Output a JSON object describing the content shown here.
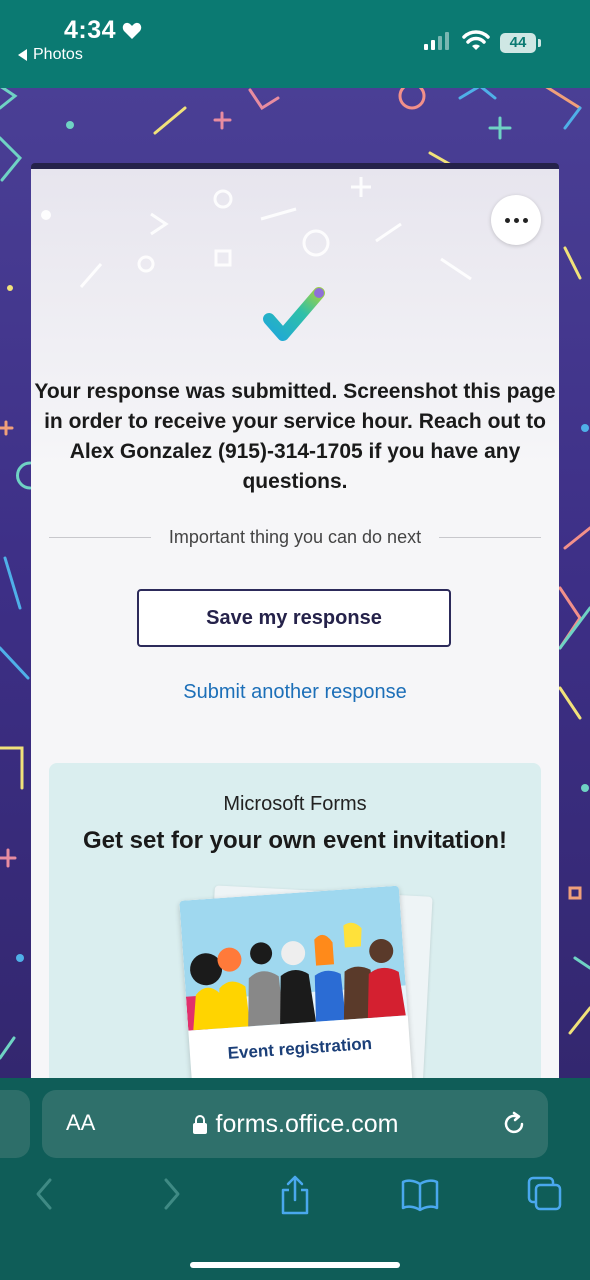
{
  "status": {
    "time": "4:34",
    "back_app": "Photos",
    "battery": "44"
  },
  "form": {
    "message": "Your response was submitted. Screenshot this page in order to receive your service hour. Reach out to Alex Gonzalez (915)-314-1705 if you have any questions.",
    "next_label": "Important thing you can do next",
    "save_label": "Save my response",
    "submit_another": "Submit another response"
  },
  "promo": {
    "brand": "Microsoft Forms",
    "title": "Get set for your own event invitation!",
    "card_label": "Event registration"
  },
  "browser": {
    "aa": "AA",
    "url": "forms.office.com"
  },
  "colors": {
    "status_bg": "#0b7a72",
    "accent": "#25224a",
    "link": "#1c6fb8"
  }
}
